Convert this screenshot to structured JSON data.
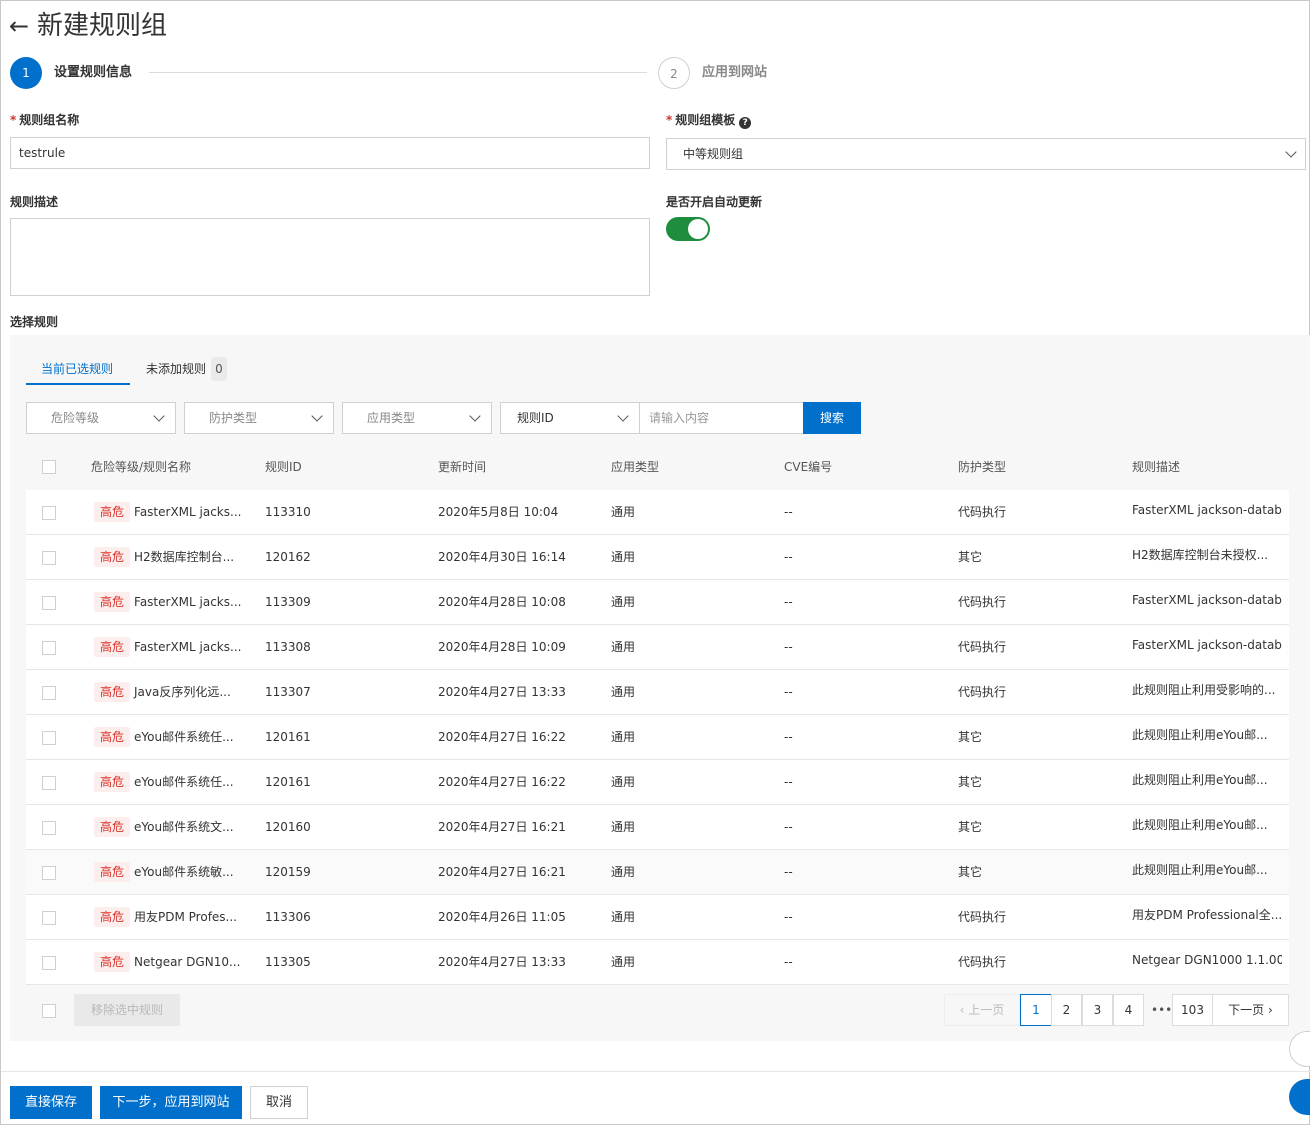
{
  "header": {
    "back_icon": "arrow-left-icon",
    "title": "新建规则组"
  },
  "steps": [
    {
      "number": "1",
      "label": "设置规则信息"
    },
    {
      "number": "2",
      "label": "应用到网站"
    }
  ],
  "form": {
    "name_label": "规则组名称",
    "name_value": "testrule",
    "template_label": "规则组模板",
    "template_value": "中等规则组",
    "desc_label": "规则描述",
    "desc_value": "",
    "auto_update_label": "是否开启自动更新",
    "auto_update_on": true,
    "required_mark": "*",
    "help_mark": "?"
  },
  "rules": {
    "section_label": "选择规则",
    "tabs": [
      {
        "label": "当前已选规则"
      },
      {
        "label": "未添加规则",
        "count": "0"
      }
    ],
    "filters": {
      "risk": "危险等级",
      "protect": "防护类型",
      "app": "应用类型",
      "field": "规则ID",
      "search_placeholder": "请输入内容",
      "search_button": "搜索"
    },
    "columns": [
      "危险等级/规则名称",
      "规则ID",
      "更新时间",
      "应用类型",
      "CVE编号",
      "防护类型",
      "规则描述"
    ],
    "rows": [
      {
        "level": "高危",
        "name": "FasterXML jacks...",
        "id": "113310",
        "time": "2020年5月8日 10:04",
        "app": "通用",
        "cve": "--",
        "protect": "代码执行",
        "desc": "FasterXML jackson-datab..."
      },
      {
        "level": "高危",
        "name": "H2数据库控制台...",
        "id": "120162",
        "time": "2020年4月30日 16:14",
        "app": "通用",
        "cve": "--",
        "protect": "其它",
        "desc": "H2数据库控制台未授权..."
      },
      {
        "level": "高危",
        "name": "FasterXML jacks...",
        "id": "113309",
        "time": "2020年4月28日 10:08",
        "app": "通用",
        "cve": "--",
        "protect": "代码执行",
        "desc": "FasterXML jackson-datab..."
      },
      {
        "level": "高危",
        "name": "FasterXML jacks...",
        "id": "113308",
        "time": "2020年4月28日 10:09",
        "app": "通用",
        "cve": "--",
        "protect": "代码执行",
        "desc": "FasterXML jackson-datab..."
      },
      {
        "level": "高危",
        "name": "Java反序列化远...",
        "id": "113307",
        "time": "2020年4月27日 13:33",
        "app": "通用",
        "cve": "--",
        "protect": "代码执行",
        "desc": "此规则阻止利用受影响的..."
      },
      {
        "level": "高危",
        "name": "eYou邮件系统任...",
        "id": "120161",
        "time": "2020年4月27日 16:22",
        "app": "通用",
        "cve": "--",
        "protect": "其它",
        "desc": "此规则阻止利用eYou邮..."
      },
      {
        "level": "高危",
        "name": "eYou邮件系统任...",
        "id": "120161",
        "time": "2020年4月27日 16:22",
        "app": "通用",
        "cve": "--",
        "protect": "其它",
        "desc": "此规则阻止利用eYou邮..."
      },
      {
        "level": "高危",
        "name": "eYou邮件系统文...",
        "id": "120160",
        "time": "2020年4月27日 16:21",
        "app": "通用",
        "cve": "--",
        "protect": "其它",
        "desc": "此规则阻止利用eYou邮..."
      },
      {
        "level": "高危",
        "name": "eYou邮件系统敏...",
        "id": "120159",
        "time": "2020年4月27日 16:21",
        "app": "通用",
        "cve": "--",
        "protect": "其它",
        "desc": "此规则阻止利用eYou邮..."
      },
      {
        "level": "高危",
        "name": "用友PDM Profes...",
        "id": "113306",
        "time": "2020年4月26日 11:05",
        "app": "通用",
        "cve": "--",
        "protect": "代码执行",
        "desc": "用友PDM Professional全..."
      },
      {
        "level": "高危",
        "name": "Netgear DGN10...",
        "id": "113305",
        "time": "2020年4月27日 13:33",
        "app": "通用",
        "cve": "--",
        "protect": "代码执行",
        "desc": "Netgear DGN1000 1.1.00..."
      }
    ],
    "remove_button": "移除选中规则",
    "pagination": {
      "prev": "上一页",
      "pages": [
        "1",
        "2",
        "3",
        "4"
      ],
      "ellipsis": "•••",
      "last": "103",
      "next": "下一页",
      "current": "1"
    }
  },
  "actions": {
    "save": "直接保存",
    "next": "下一步，应用到网站",
    "cancel": "取消"
  },
  "colors": {
    "primary": "#0070cc",
    "danger": "#d93026",
    "toggle_on": "#1e8e3e"
  }
}
